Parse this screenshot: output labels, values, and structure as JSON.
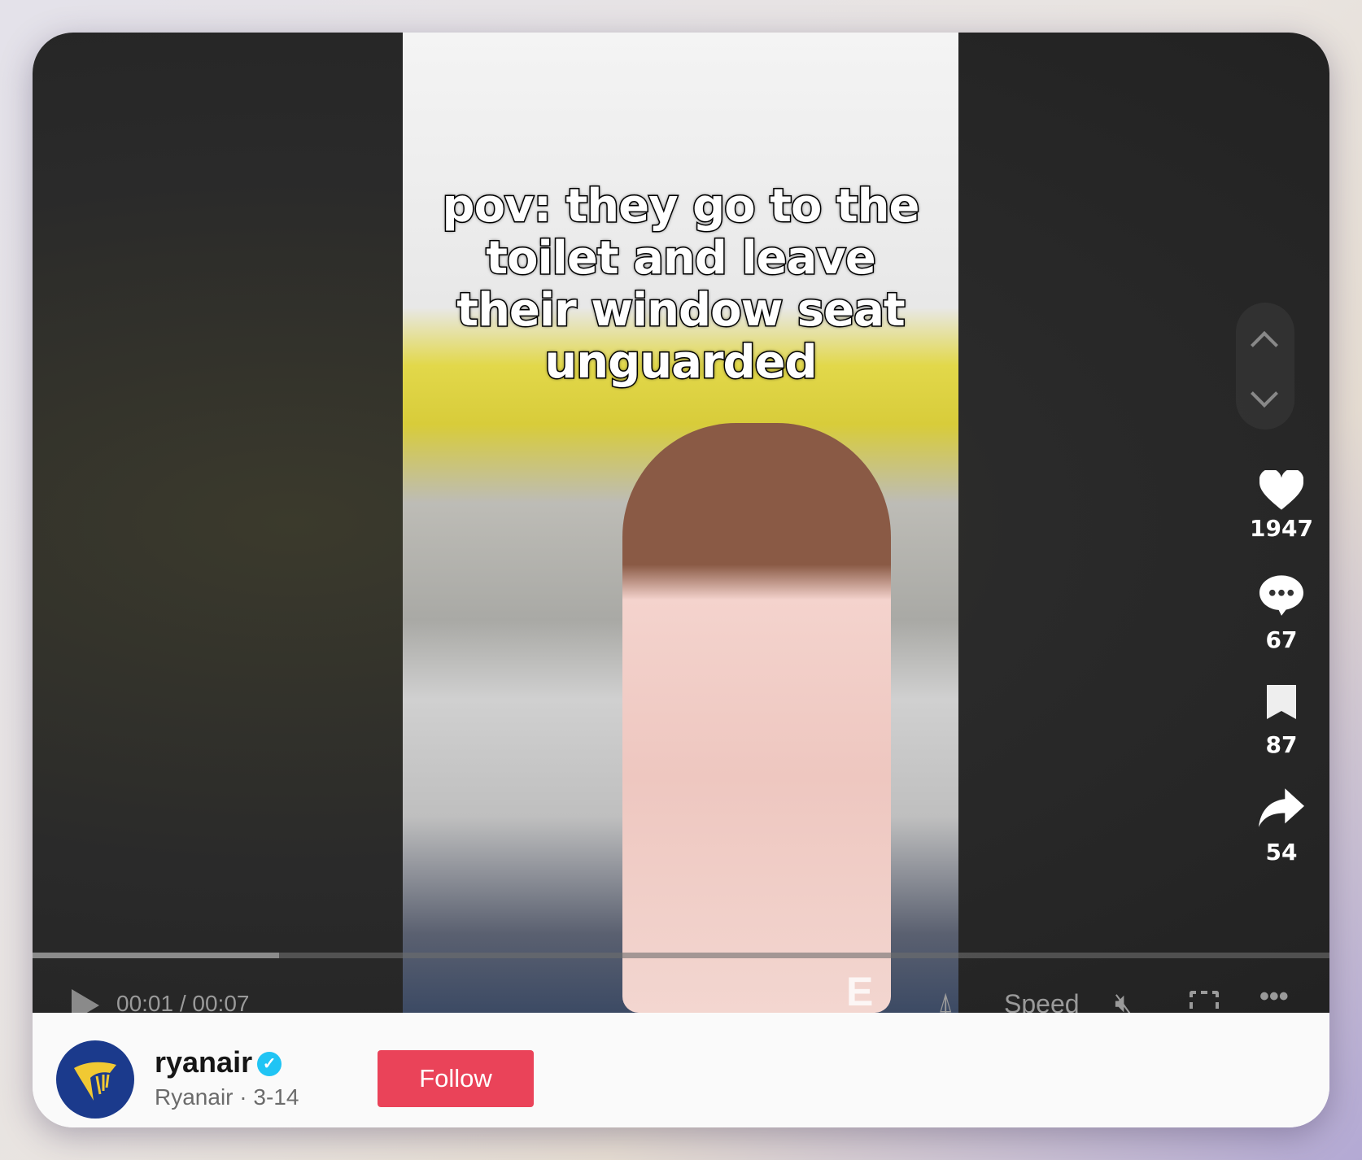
{
  "video": {
    "caption_lines": [
      "pov: they go to the",
      "toilet and leave",
      "their window seat",
      "unguarded"
    ],
    "watermark": "E",
    "progress_fraction": 0.19,
    "time_label": "00:01 / 00:07",
    "speed_label": "Speed",
    "icons": [
      "play-icon",
      "floating-player-icon",
      "mute-icon",
      "fullscreen-icon",
      "more-icon"
    ]
  },
  "actions": {
    "likes": "1947",
    "comments": "67",
    "saves": "87",
    "shares": "54"
  },
  "author": {
    "handle": "ryanair",
    "subtitle": "Ryanair · 3-14",
    "verified": true,
    "follow_label": "Follow"
  },
  "colors": {
    "follow": "#ea4359",
    "verified": "#20c4f4",
    "avatar_bg": "#1b3a8c",
    "avatar_logo": "#f1c933"
  }
}
